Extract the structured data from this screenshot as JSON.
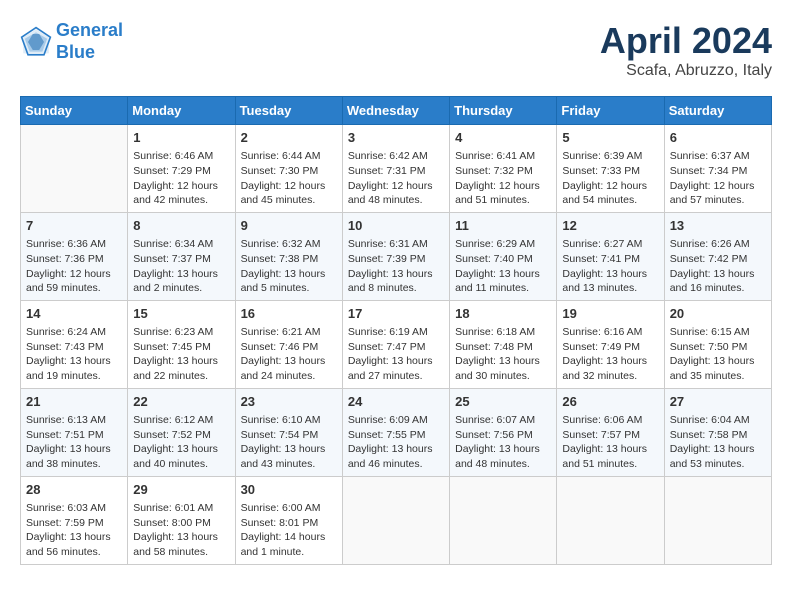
{
  "header": {
    "logo_line1": "General",
    "logo_line2": "Blue",
    "month": "April 2024",
    "location": "Scafa, Abruzzo, Italy"
  },
  "weekdays": [
    "Sunday",
    "Monday",
    "Tuesday",
    "Wednesday",
    "Thursday",
    "Friday",
    "Saturday"
  ],
  "weeks": [
    [
      {
        "day": "",
        "sunrise": "",
        "sunset": "",
        "daylight": ""
      },
      {
        "day": "1",
        "sunrise": "Sunrise: 6:46 AM",
        "sunset": "Sunset: 7:29 PM",
        "daylight": "Daylight: 12 hours and 42 minutes."
      },
      {
        "day": "2",
        "sunrise": "Sunrise: 6:44 AM",
        "sunset": "Sunset: 7:30 PM",
        "daylight": "Daylight: 12 hours and 45 minutes."
      },
      {
        "day": "3",
        "sunrise": "Sunrise: 6:42 AM",
        "sunset": "Sunset: 7:31 PM",
        "daylight": "Daylight: 12 hours and 48 minutes."
      },
      {
        "day": "4",
        "sunrise": "Sunrise: 6:41 AM",
        "sunset": "Sunset: 7:32 PM",
        "daylight": "Daylight: 12 hours and 51 minutes."
      },
      {
        "day": "5",
        "sunrise": "Sunrise: 6:39 AM",
        "sunset": "Sunset: 7:33 PM",
        "daylight": "Daylight: 12 hours and 54 minutes."
      },
      {
        "day": "6",
        "sunrise": "Sunrise: 6:37 AM",
        "sunset": "Sunset: 7:34 PM",
        "daylight": "Daylight: 12 hours and 57 minutes."
      }
    ],
    [
      {
        "day": "7",
        "sunrise": "Sunrise: 6:36 AM",
        "sunset": "Sunset: 7:36 PM",
        "daylight": "Daylight: 12 hours and 59 minutes."
      },
      {
        "day": "8",
        "sunrise": "Sunrise: 6:34 AM",
        "sunset": "Sunset: 7:37 PM",
        "daylight": "Daylight: 13 hours and 2 minutes."
      },
      {
        "day": "9",
        "sunrise": "Sunrise: 6:32 AM",
        "sunset": "Sunset: 7:38 PM",
        "daylight": "Daylight: 13 hours and 5 minutes."
      },
      {
        "day": "10",
        "sunrise": "Sunrise: 6:31 AM",
        "sunset": "Sunset: 7:39 PM",
        "daylight": "Daylight: 13 hours and 8 minutes."
      },
      {
        "day": "11",
        "sunrise": "Sunrise: 6:29 AM",
        "sunset": "Sunset: 7:40 PM",
        "daylight": "Daylight: 13 hours and 11 minutes."
      },
      {
        "day": "12",
        "sunrise": "Sunrise: 6:27 AM",
        "sunset": "Sunset: 7:41 PM",
        "daylight": "Daylight: 13 hours and 13 minutes."
      },
      {
        "day": "13",
        "sunrise": "Sunrise: 6:26 AM",
        "sunset": "Sunset: 7:42 PM",
        "daylight": "Daylight: 13 hours and 16 minutes."
      }
    ],
    [
      {
        "day": "14",
        "sunrise": "Sunrise: 6:24 AM",
        "sunset": "Sunset: 7:43 PM",
        "daylight": "Daylight: 13 hours and 19 minutes."
      },
      {
        "day": "15",
        "sunrise": "Sunrise: 6:23 AM",
        "sunset": "Sunset: 7:45 PM",
        "daylight": "Daylight: 13 hours and 22 minutes."
      },
      {
        "day": "16",
        "sunrise": "Sunrise: 6:21 AM",
        "sunset": "Sunset: 7:46 PM",
        "daylight": "Daylight: 13 hours and 24 minutes."
      },
      {
        "day": "17",
        "sunrise": "Sunrise: 6:19 AM",
        "sunset": "Sunset: 7:47 PM",
        "daylight": "Daylight: 13 hours and 27 minutes."
      },
      {
        "day": "18",
        "sunrise": "Sunrise: 6:18 AM",
        "sunset": "Sunset: 7:48 PM",
        "daylight": "Daylight: 13 hours and 30 minutes."
      },
      {
        "day": "19",
        "sunrise": "Sunrise: 6:16 AM",
        "sunset": "Sunset: 7:49 PM",
        "daylight": "Daylight: 13 hours and 32 minutes."
      },
      {
        "day": "20",
        "sunrise": "Sunrise: 6:15 AM",
        "sunset": "Sunset: 7:50 PM",
        "daylight": "Daylight: 13 hours and 35 minutes."
      }
    ],
    [
      {
        "day": "21",
        "sunrise": "Sunrise: 6:13 AM",
        "sunset": "Sunset: 7:51 PM",
        "daylight": "Daylight: 13 hours and 38 minutes."
      },
      {
        "day": "22",
        "sunrise": "Sunrise: 6:12 AM",
        "sunset": "Sunset: 7:52 PM",
        "daylight": "Daylight: 13 hours and 40 minutes."
      },
      {
        "day": "23",
        "sunrise": "Sunrise: 6:10 AM",
        "sunset": "Sunset: 7:54 PM",
        "daylight": "Daylight: 13 hours and 43 minutes."
      },
      {
        "day": "24",
        "sunrise": "Sunrise: 6:09 AM",
        "sunset": "Sunset: 7:55 PM",
        "daylight": "Daylight: 13 hours and 46 minutes."
      },
      {
        "day": "25",
        "sunrise": "Sunrise: 6:07 AM",
        "sunset": "Sunset: 7:56 PM",
        "daylight": "Daylight: 13 hours and 48 minutes."
      },
      {
        "day": "26",
        "sunrise": "Sunrise: 6:06 AM",
        "sunset": "Sunset: 7:57 PM",
        "daylight": "Daylight: 13 hours and 51 minutes."
      },
      {
        "day": "27",
        "sunrise": "Sunrise: 6:04 AM",
        "sunset": "Sunset: 7:58 PM",
        "daylight": "Daylight: 13 hours and 53 minutes."
      }
    ],
    [
      {
        "day": "28",
        "sunrise": "Sunrise: 6:03 AM",
        "sunset": "Sunset: 7:59 PM",
        "daylight": "Daylight: 13 hours and 56 minutes."
      },
      {
        "day": "29",
        "sunrise": "Sunrise: 6:01 AM",
        "sunset": "Sunset: 8:00 PM",
        "daylight": "Daylight: 13 hours and 58 minutes."
      },
      {
        "day": "30",
        "sunrise": "Sunrise: 6:00 AM",
        "sunset": "Sunset: 8:01 PM",
        "daylight": "Daylight: 14 hours and 1 minute."
      },
      {
        "day": "",
        "sunrise": "",
        "sunset": "",
        "daylight": ""
      },
      {
        "day": "",
        "sunrise": "",
        "sunset": "",
        "daylight": ""
      },
      {
        "day": "",
        "sunrise": "",
        "sunset": "",
        "daylight": ""
      },
      {
        "day": "",
        "sunrise": "",
        "sunset": "",
        "daylight": ""
      }
    ]
  ]
}
